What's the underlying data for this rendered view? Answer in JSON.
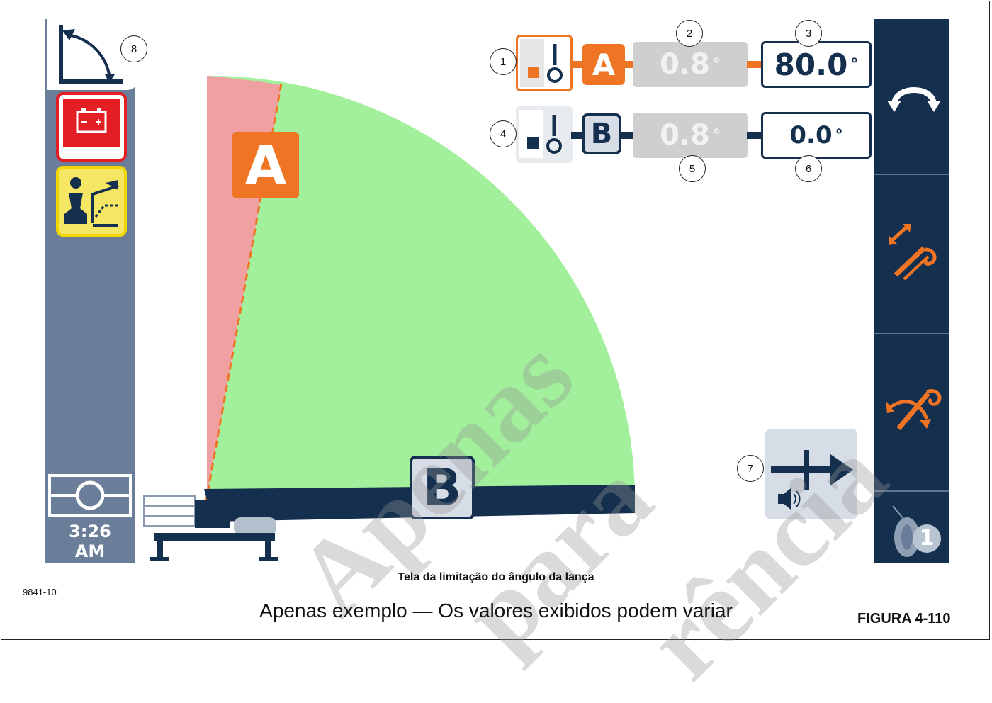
{
  "header_icon": "boom-angle-arc-icon",
  "left_panel": {
    "icons": [
      "battery-warning-icon",
      "operator-joystick-icon",
      "crane-level-icon"
    ],
    "time": {
      "clock": "3:26",
      "meridiem": "AM"
    }
  },
  "limit_a": {
    "label": "A",
    "current": "0.8",
    "limit": "80.0",
    "unit": "°"
  },
  "limit_b": {
    "label": "B",
    "current": "0.8",
    "limit": "0.0",
    "unit": "°"
  },
  "diagram": {
    "zone_a_label": "A",
    "zone_b_label": "B",
    "colors": {
      "allowed": "#a2f09c",
      "restricted": "#f0a0a0",
      "accent": "#ef7424",
      "dark": "#15304f"
    }
  },
  "right_panel": {
    "icons": [
      "swing-icon",
      "telescope-icon",
      "boom-lift-icon",
      "winch-1-icon"
    ],
    "winch_number": "1"
  },
  "alarm_button_icon": "arrow-right-horn-icon",
  "callouts": [
    "1",
    "2",
    "3",
    "4",
    "5",
    "6",
    "7",
    "8"
  ],
  "caption": {
    "figure_code": "9841-10",
    "title": "Tela da limitação do ângulo da lança",
    "subtitle": "Apenas exemplo — Os valores exibidos podem variar",
    "figure_label": "FIGURA 4-110"
  },
  "watermark": {
    "line1": "Apenas",
    "line2": "para",
    "line3": "rência"
  }
}
